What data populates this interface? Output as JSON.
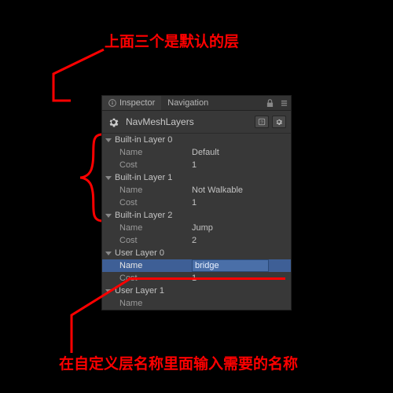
{
  "annotations": {
    "top": "上面三个是默认的层",
    "bottom": "在自定义层名称里面输入需要的名称"
  },
  "tabs": {
    "inspector": "Inspector",
    "navigation": "Navigation"
  },
  "header": {
    "title": "NavMeshLayers"
  },
  "layers": [
    {
      "header": "Built-in Layer 0",
      "name_label": "Name",
      "name_value": "Default",
      "cost_label": "Cost",
      "cost_value": "1"
    },
    {
      "header": "Built-in Layer 1",
      "name_label": "Name",
      "name_value": "Not Walkable",
      "cost_label": "Cost",
      "cost_value": "1"
    },
    {
      "header": "Built-in Layer 2",
      "name_label": "Name",
      "name_value": "Jump",
      "cost_label": "Cost",
      "cost_value": "2"
    },
    {
      "header": "User Layer 0",
      "name_label": "Name",
      "name_value": "bridge",
      "cost_label": "Cost",
      "cost_value": "1"
    },
    {
      "header": "User Layer 1",
      "name_label": "Name",
      "name_value": ""
    }
  ]
}
